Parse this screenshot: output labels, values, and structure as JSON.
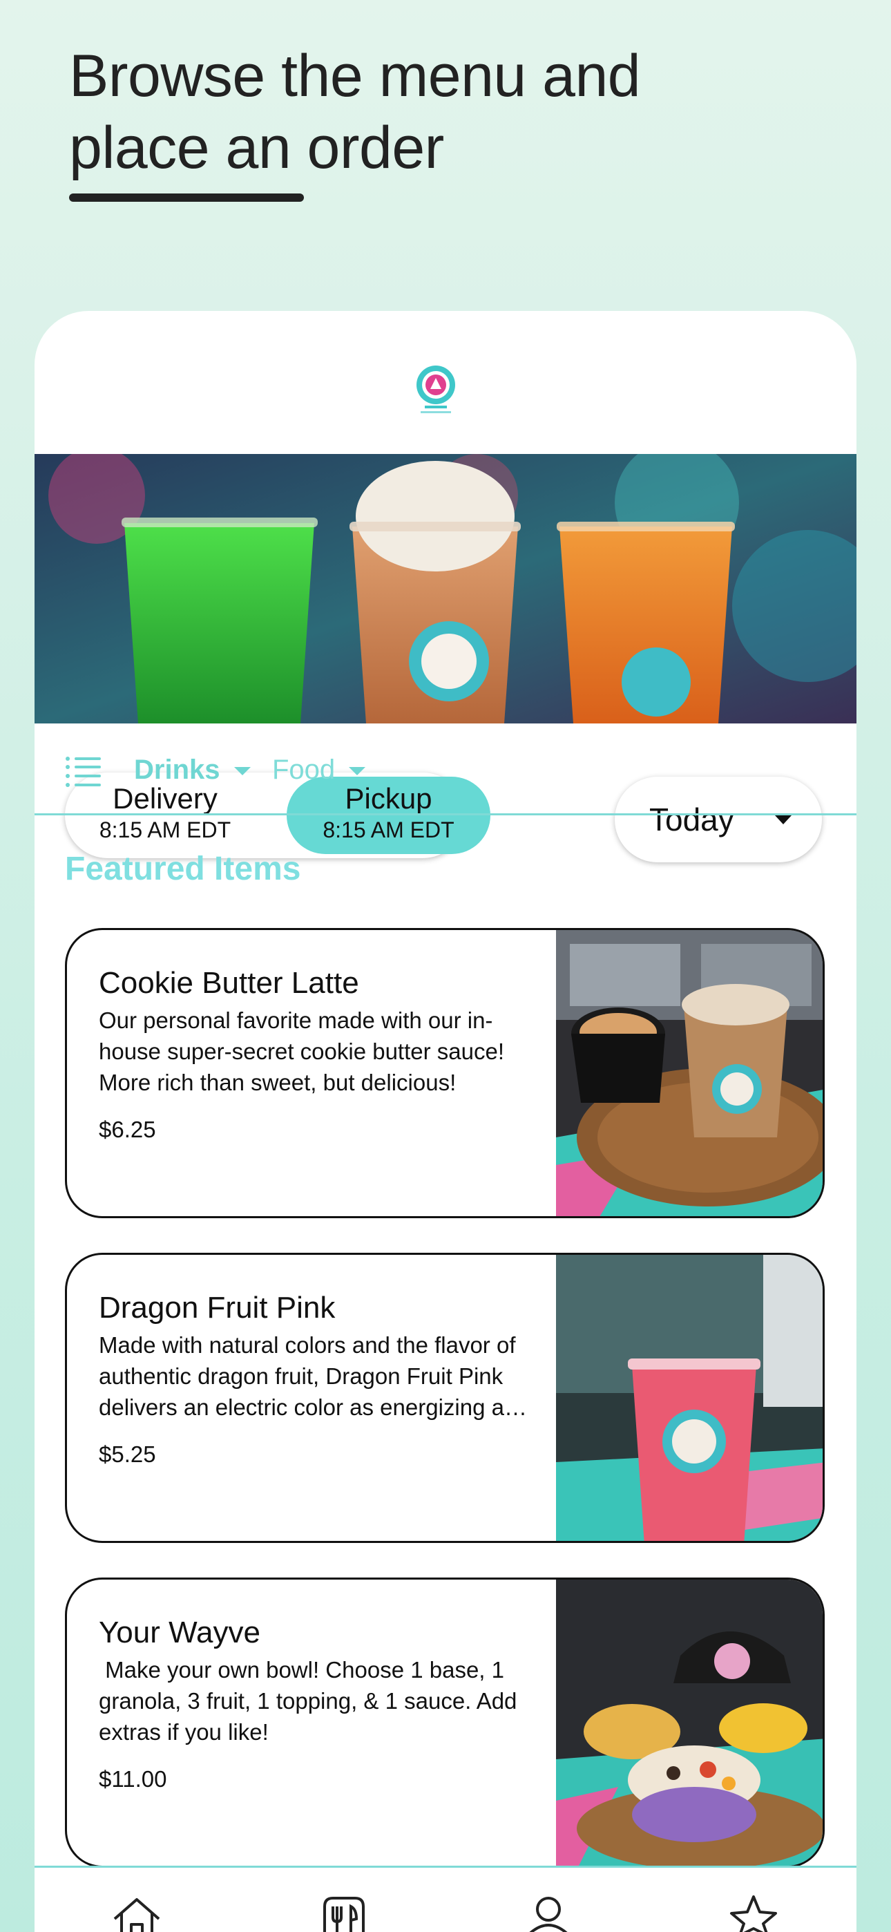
{
  "headline": {
    "line1": "Browse the menu and",
    "line2": "place an order"
  },
  "order_modes": {
    "delivery": {
      "label": "Delivery",
      "time": "8:15 AM EDT"
    },
    "pickup": {
      "label": "Pickup",
      "time": "8:15 AM EDT",
      "selected": true
    }
  },
  "day_select": {
    "value": "Today"
  },
  "categories": [
    {
      "label": "Drinks",
      "active": true
    },
    {
      "label": "Food",
      "active": false
    }
  ],
  "featured": {
    "title": "Featured Items",
    "items": [
      {
        "name": "Cookie Butter Latte",
        "description": "Our personal favorite made with our in-house super-secret cookie butter sauce! More rich than sweet, but delicious!",
        "price": "$6.25"
      },
      {
        "name": "Dragon Fruit Pink",
        "description": "Made with natural colors and the flavor of authentic dragon fruit, Dragon Fruit Pink delivers an electric color as energizing as it tastes.",
        "price": "$5.25"
      },
      {
        "name": "Your Wayve",
        "description": " Make your own bowl! Choose 1 base, 1 granola, 3 fruit, 1 topping, & 1 sauce. Add extras if you like!",
        "price": "$11.00"
      }
    ]
  },
  "tabs": [
    {
      "icon": "home-icon"
    },
    {
      "icon": "menu-icon"
    },
    {
      "icon": "account-icon"
    },
    {
      "icon": "rewards-icon"
    }
  ],
  "colors": {
    "accent": "#66d9d4",
    "featured_title": "#7fdfe0",
    "background": "#c9eee3"
  }
}
